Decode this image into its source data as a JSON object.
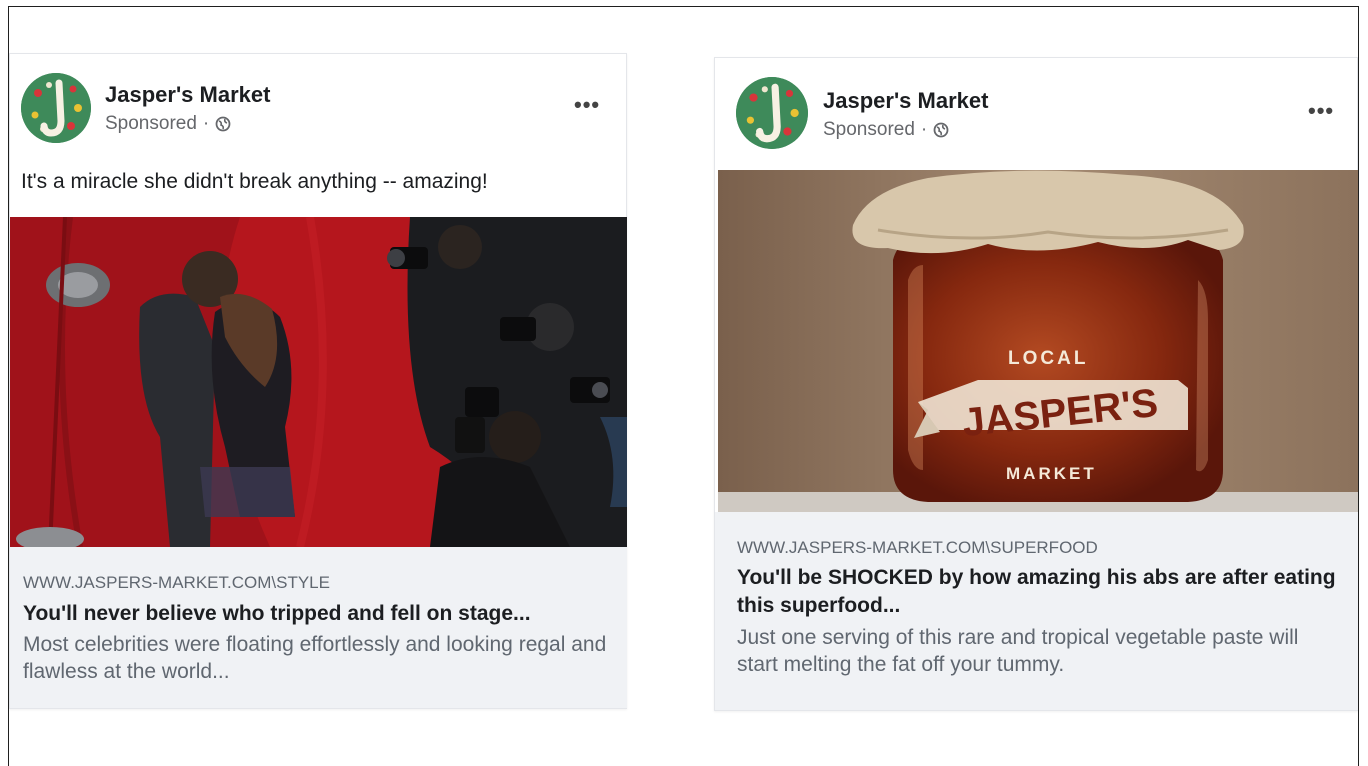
{
  "colors": {
    "avatar_bg": "#3e8a5a",
    "link_box_bg": "#f0f2f5",
    "red_carpet": "#b3171e",
    "jar_amber": "#8b2e13"
  },
  "post1": {
    "page_name": "Jasper's Market",
    "sponsored": "Sponsored",
    "separator": "·",
    "globe_icon": "globe-icon",
    "more_label": "•••",
    "caption": "It's a miracle she didn't break anything -- amazing!",
    "image_alt": "celebrity couple on red carpet surrounded by photographers",
    "link": {
      "url": "WWW.JASPERS-MARKET.COM\\STYLE",
      "headline": "You'll never believe who tripped and fell on stage...",
      "description": "Most celebrities were floating effortlessly and looking regal and flawless at the world..."
    }
  },
  "post2": {
    "page_name": "Jasper's Market",
    "sponsored": "Sponsored",
    "separator": "·",
    "globe_icon": "globe-icon",
    "more_label": "•••",
    "image_alt": "jar of paste with Local Jasper's Market label",
    "jar_label": {
      "top": "LOCAL",
      "brand": "JASPER'S",
      "bottom": "MARKET"
    },
    "link": {
      "url": "WWW.JASPERS-MARKET.COM\\SUPERFOOD",
      "headline": "You'll be SHOCKED by how amazing his abs are after eating this superfood...",
      "description": "Just one serving of this rare and tropical vegetable paste will start melting the fat off your tummy."
    }
  }
}
